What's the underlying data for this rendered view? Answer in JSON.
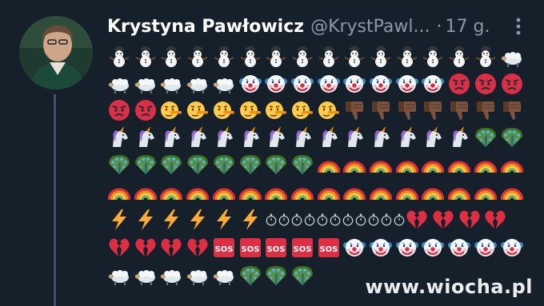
{
  "tweet": {
    "author_name": "Krystyna Pawłowicz",
    "author_handle": "@KrystPawl...",
    "separator": "·",
    "time": "17 g.",
    "more_icon": "more-vertical-icon",
    "emoji_rows": [
      [
        "snowman",
        "snowman",
        "snowman",
        "snowman",
        "snowman",
        "snowman",
        "snowman",
        "snowman",
        "snowman",
        "snowman",
        "snowman",
        "snowman",
        "snowman",
        "snowman",
        "snowman",
        "sheep"
      ],
      [
        "sheep",
        "sheep",
        "sheep",
        "sheep",
        "sheep",
        "clown",
        "clown",
        "clown",
        "clown",
        "clown",
        "clown",
        "clown",
        "clown",
        "angry",
        "angry",
        "angry"
      ],
      [
        "angry",
        "angry",
        "lying",
        "lying",
        "lying",
        "lying",
        "lying",
        "lying",
        "lying",
        "thumbs-down",
        "thumbs-down",
        "thumbs-down",
        "thumbs-down",
        "thumbs-down",
        "thumbs-down",
        "thumbs-down"
      ],
      [
        "unicorn",
        "unicorn",
        "unicorn",
        "unicorn",
        "unicorn",
        "unicorn",
        "unicorn",
        "unicorn",
        "unicorn",
        "unicorn",
        "unicorn",
        "unicorn",
        "unicorn",
        "unicorn",
        "peacock",
        "peacock"
      ],
      [
        "peacock",
        "peacock",
        "peacock",
        "peacock",
        "peacock",
        "peacock",
        "peacock",
        "peacock",
        "rainbow",
        "rainbow",
        "rainbow",
        "rainbow",
        "rainbow",
        "rainbow",
        "rainbow",
        "rainbow"
      ],
      [
        "rainbow",
        "rainbow",
        "rainbow",
        "rainbow",
        "rainbow",
        "rainbow",
        "rainbow",
        "rainbow",
        "rainbow",
        "rainbow",
        "rainbow",
        "rainbow",
        "rainbow",
        "rainbow",
        "rainbow",
        "rainbow"
      ],
      [
        "lightning",
        "lightning",
        "lightning",
        "lightning",
        "lightning",
        "lightning",
        "stopwatch",
        "stopwatch",
        "stopwatch",
        "stopwatch",
        "stopwatch",
        "stopwatch",
        "stopwatch",
        "stopwatch",
        "stopwatch",
        "stopwatch",
        "stopwatch",
        "broken-heart",
        "broken-heart",
        "broken-heart",
        "broken-heart"
      ],
      [
        "broken-heart",
        "broken-heart",
        "broken-heart",
        "broken-heart",
        "sos",
        "sos",
        "sos",
        "sos",
        "sos",
        "clown",
        "clown",
        "clown",
        "clown",
        "clown",
        "clown",
        "clown"
      ],
      [
        "sheep",
        "sheep",
        "sheep",
        "sheep",
        "sheep",
        "peacock",
        "peacock",
        "peacock"
      ]
    ]
  },
  "sos_label": "SOS",
  "watermark": "www.wiocha.pl"
}
